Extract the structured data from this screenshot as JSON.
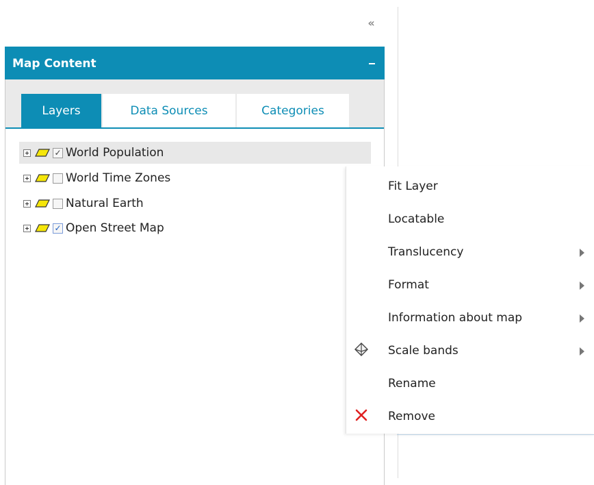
{
  "collapse": {
    "glyph": "«"
  },
  "panel": {
    "title": "Map Content",
    "tabs": [
      {
        "label": "Layers",
        "active": true
      },
      {
        "label": "Data Sources",
        "active": false
      },
      {
        "label": "Categories",
        "active": false
      }
    ]
  },
  "layers": [
    {
      "name": "World Population",
      "checked": true,
      "selected": true
    },
    {
      "name": "World Time Zones",
      "checked": false,
      "selected": false
    },
    {
      "name": "Natural Earth",
      "checked": false,
      "selected": false
    },
    {
      "name": "Open Street Map",
      "checked": true,
      "selected": false
    }
  ],
  "context_menu": {
    "items": [
      {
        "label": "Fit Layer",
        "submenu": false,
        "icon": ""
      },
      {
        "label": "Locatable",
        "submenu": false,
        "icon": ""
      },
      {
        "label": "Translucency",
        "submenu": true,
        "icon": ""
      },
      {
        "label": "Format",
        "submenu": true,
        "icon": ""
      },
      {
        "label": "Information about map",
        "submenu": true,
        "icon": ""
      },
      {
        "label": "Scale bands",
        "submenu": true,
        "icon": "pyramid-icon"
      },
      {
        "label": "Rename",
        "submenu": false,
        "icon": ""
      },
      {
        "label": "Remove",
        "submenu": false,
        "icon": "remove-x-icon"
      }
    ]
  },
  "colors": {
    "accent": "#0d8db5",
    "layer_icon": "#f5e60a",
    "remove": "#e02020"
  }
}
